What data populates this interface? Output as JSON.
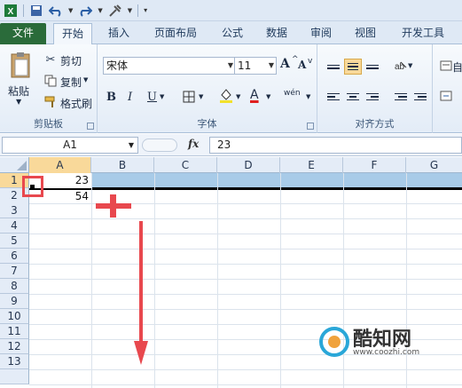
{
  "qat": {
    "icons": [
      "excel-logo-icon",
      "save-icon",
      "undo-icon",
      "redo-icon",
      "tools-icon",
      "customize-icon"
    ]
  },
  "tabs": [
    {
      "label": "文件"
    },
    {
      "label": "开始"
    },
    {
      "label": "插入"
    },
    {
      "label": "页面布局"
    },
    {
      "label": "公式"
    },
    {
      "label": "数据"
    },
    {
      "label": "审阅"
    },
    {
      "label": "视图"
    },
    {
      "label": "开发工具"
    }
  ],
  "clipboard": {
    "paste": "粘贴",
    "cut": "剪切",
    "copy": "复制",
    "format_painter": "格式刷",
    "group": "剪贴板"
  },
  "font": {
    "name": "宋体",
    "size": "11",
    "group": "字体",
    "grow": "A",
    "shrink": "A",
    "bold": "B",
    "italic": "I",
    "underline": "U",
    "wen": "wén",
    "font_color_letter": "A"
  },
  "alignment": {
    "group": "对齐方式",
    "cut_label": "自"
  },
  "formula_bar": {
    "name_box": "A1",
    "fx": "fx",
    "value": "23"
  },
  "columns": [
    "A",
    "B",
    "C",
    "D",
    "E",
    "F",
    "G"
  ],
  "rows": [
    "1",
    "2",
    "3",
    "4",
    "5",
    "6",
    "7",
    "8",
    "9",
    "10",
    "11",
    "12",
    "13"
  ],
  "cells": {
    "A1": "23",
    "A2": "54"
  },
  "watermark": {
    "title": "酷知网",
    "url": "www.coozhi.com"
  },
  "colors": {
    "file_tab": "#2a6b3a",
    "selection_header": "#f9d99a",
    "selection_row": "#a8cbe8",
    "annotation_red": "#e8484e"
  }
}
